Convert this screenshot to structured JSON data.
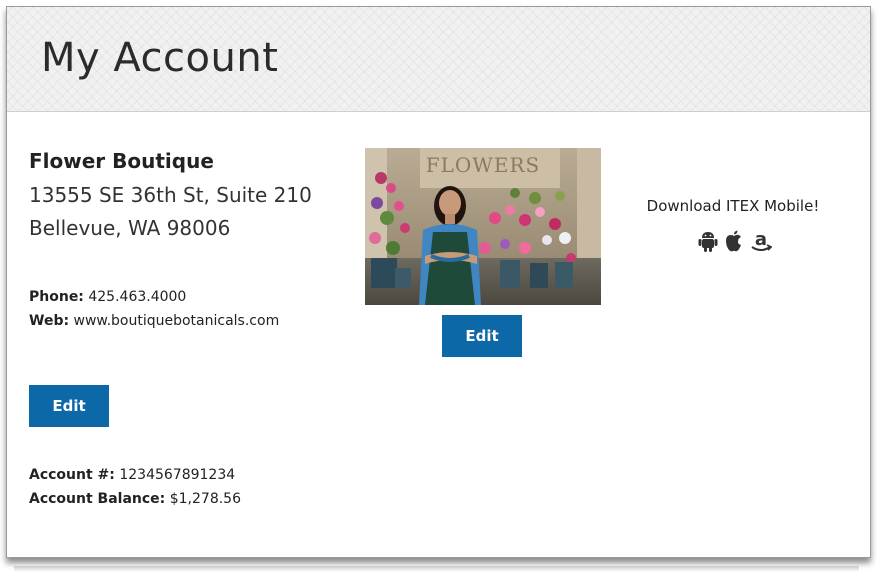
{
  "page": {
    "title": "My Account"
  },
  "business": {
    "name": "Flower Boutique",
    "address_line1": "13555 SE 36th St, Suite 210",
    "address_line2": "Bellevue, WA 98006"
  },
  "contact": {
    "phone_label": "Phone:",
    "phone_value": "425.463.4000",
    "web_label": "Web:",
    "web_value": "www.boutiquebotanicals.com"
  },
  "buttons": {
    "edit_info": "Edit",
    "edit_photo": "Edit"
  },
  "account": {
    "number_label": "Account #:",
    "number_value": "1234567891234",
    "balance_label": "Account Balance:",
    "balance_value": "$1,278.56"
  },
  "photo": {
    "sign_text": "FLOWERS"
  },
  "mobile": {
    "text": "Download ITEX Mobile!",
    "icons": [
      "android-icon",
      "apple-icon",
      "amazon-icon"
    ]
  },
  "colors": {
    "button": "#0d68a8",
    "header_bg": "#f1f1f1"
  }
}
